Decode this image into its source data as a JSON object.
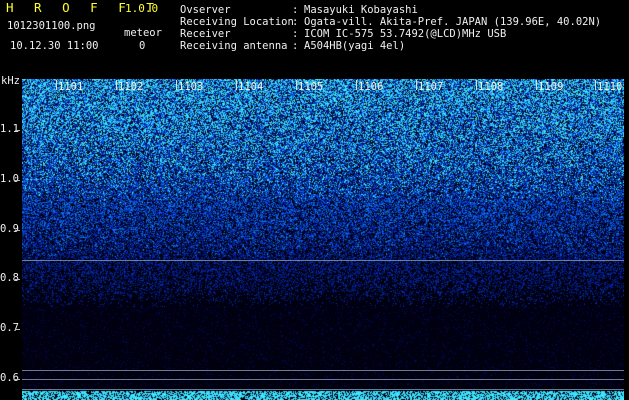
{
  "header": {
    "app_title": "H R O F F T",
    "app_version": "1.0.0",
    "file_name": "1012301100.png",
    "date_time": "10.12.30 11:00",
    "meteor_label": "meteor",
    "meteor_count": "0"
  },
  "info": [
    {
      "label": "Ovserver",
      "sep": ":",
      "value": "Masayuki Kobayashi"
    },
    {
      "label": "Receiving Location",
      "sep": ":",
      "value": "Ogata-vill. Akita-Pref. JAPAN (139.96E, 40.02N)"
    },
    {
      "label": "Receiver",
      "sep": ":",
      "value": "ICOM IC-575 53.7492(@LCD)MHz USB"
    },
    {
      "label": "Receiving antenna",
      "sep": ":",
      "value": "A504HB(yagi 4el)"
    }
  ],
  "axis": {
    "unit": "kHz",
    "y_ticks": [
      "1.1",
      "1.0",
      "0.9",
      "0.8",
      "0.7",
      "0.6"
    ],
    "time_ticks": [
      "1101",
      "1102",
      "1103",
      "1104",
      "1105",
      "1106",
      "1107",
      "1108",
      "1109",
      "1110"
    ]
  },
  "colors": {
    "header_highlight": "#ffff33",
    "text": "#f0f0f0",
    "background": "#000000",
    "spectrum_low": "#000018",
    "spectrum_mid": "#1e4dff",
    "spectrum_high": "#36e0ff"
  }
}
